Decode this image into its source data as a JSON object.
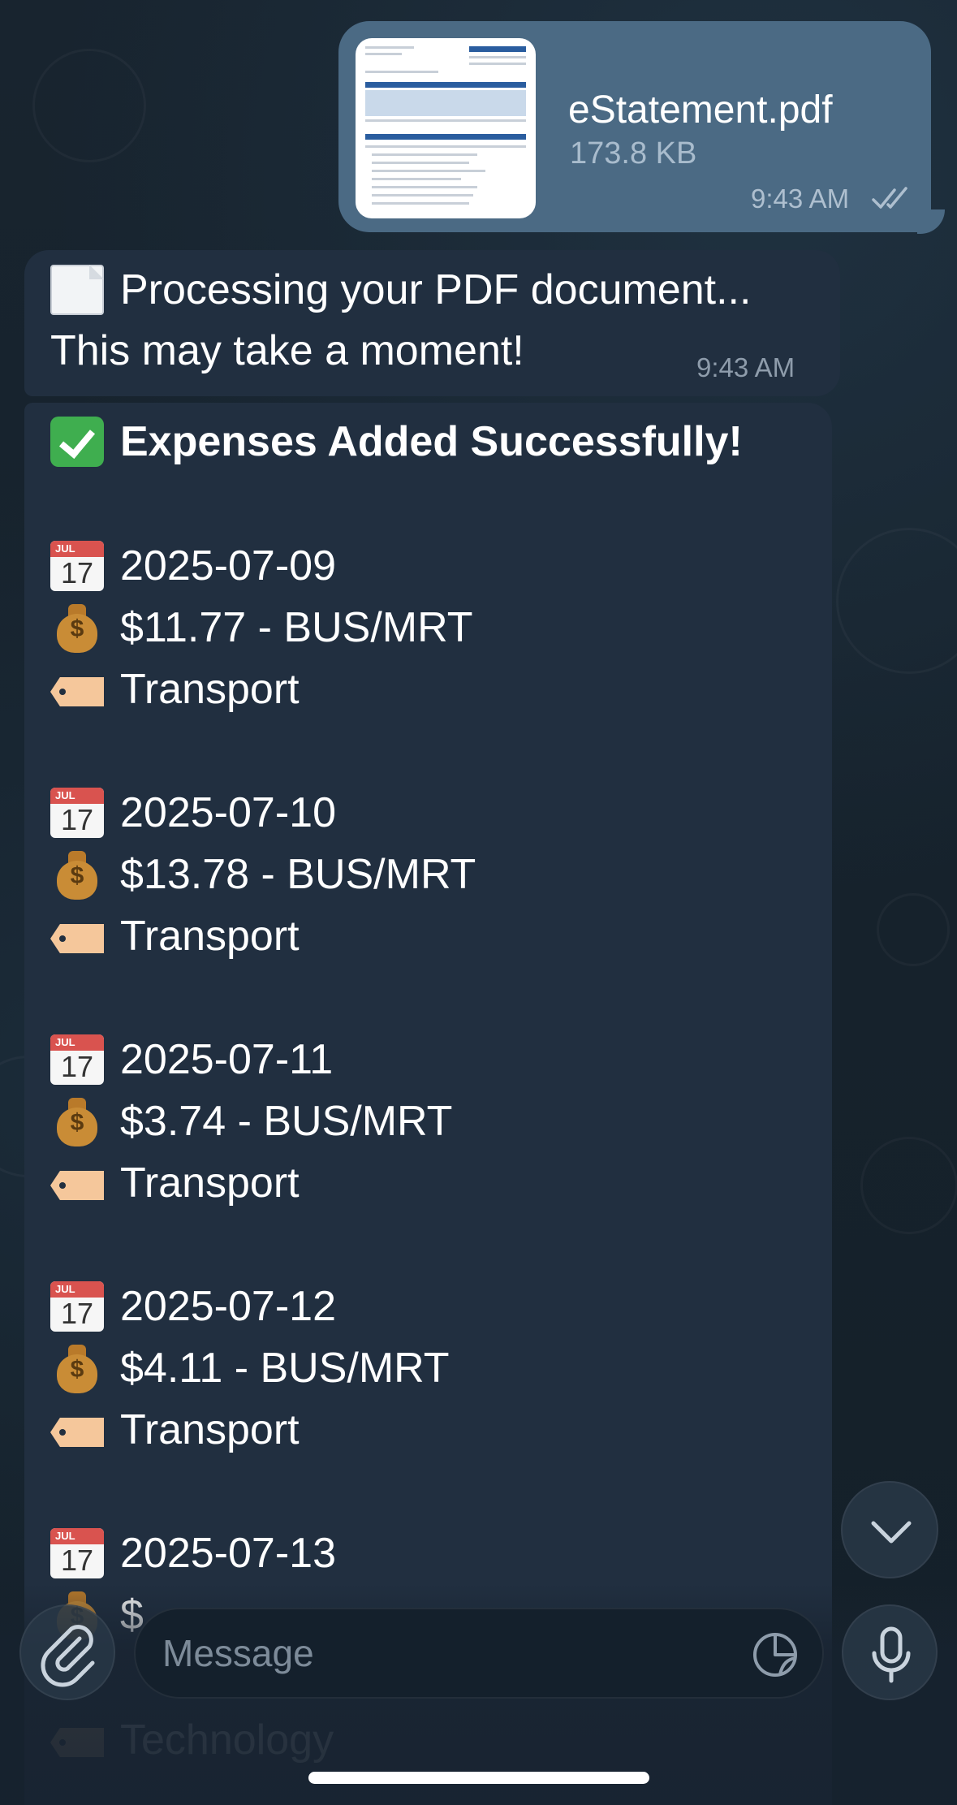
{
  "colors": {
    "outgoing_bubble": "#4b6a84",
    "incoming_bubble": "#212f40",
    "background": "#17222f",
    "meta_text": "#8e9cab"
  },
  "outgoing_file": {
    "file_name": "eStatement.pdf",
    "file_size": "173.8 KB",
    "time": "9:43 AM",
    "status_icon": "double-check-icon"
  },
  "processing_message": {
    "icon": "page-facing-up-emoji",
    "line1": "Processing your PDF document...",
    "line2": "This may take a moment!",
    "time": "9:43 AM"
  },
  "expenses_message": {
    "header_icon": "check-mark-button-emoji",
    "header": "Expenses Added Successfully!",
    "entries": [
      {
        "date": "2025-07-09",
        "amount": "$11.77 - BUS/MRT",
        "category": "Transport"
      },
      {
        "date": "2025-07-10",
        "amount": "$13.78 - BUS/MRT",
        "category": "Transport"
      },
      {
        "date": "2025-07-11",
        "amount": "$3.74 - BUS/MRT",
        "category": "Transport"
      },
      {
        "date": "2025-07-12",
        "amount": "$4.11 - BUS/MRT",
        "category": "Transport"
      },
      {
        "date": "2025-07-13",
        "amount": "$",
        "category": "Technology"
      }
    ]
  },
  "input_bar": {
    "placeholder": "Message"
  },
  "calendar_icon_month": "JUL",
  "calendar_icon_day": "17"
}
